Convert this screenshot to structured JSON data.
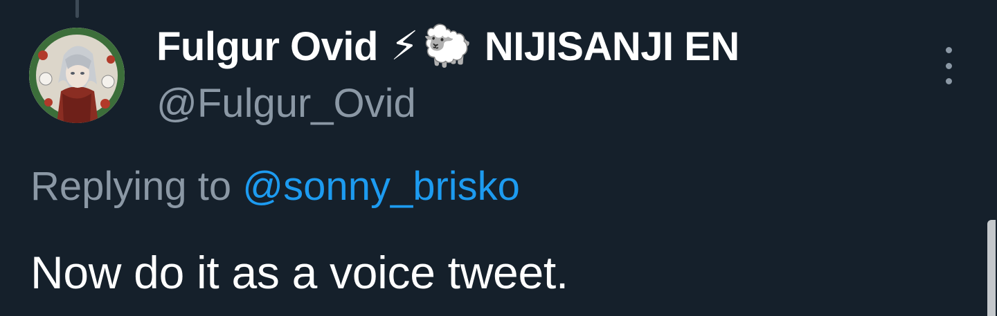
{
  "tweet": {
    "author": {
      "display_name": "Fulgur Ovid",
      "name_emojis": [
        "⚡",
        "🐑"
      ],
      "affiliation": "NIJISANJI EN",
      "handle": "@Fulgur_Ovid",
      "avatar_icon": "avatar-image"
    },
    "replying_label": "Replying to",
    "replying_to": "@sonny_brisko",
    "text": "Now do it as a voice tweet.",
    "more_icon": "more-vertical-icon"
  },
  "colors": {
    "background": "#15202b",
    "primary_text": "#ffffff",
    "secondary_text": "#8b98a5",
    "link": "#1d9bf0"
  }
}
